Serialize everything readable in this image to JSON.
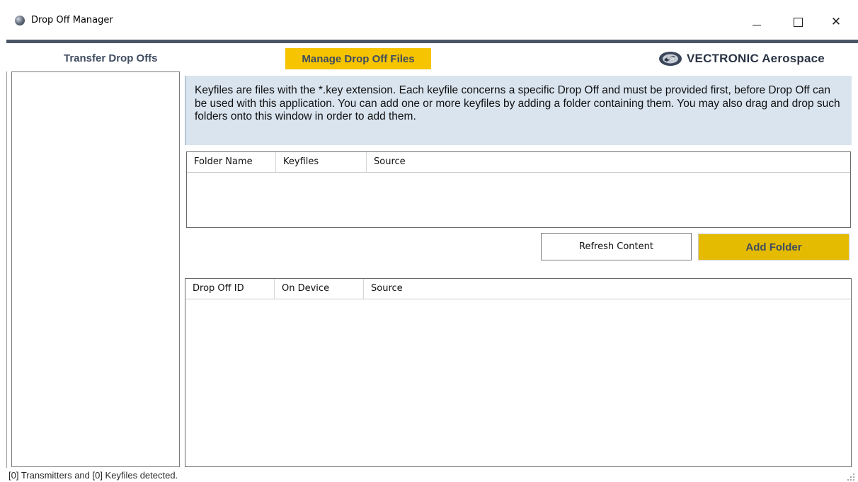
{
  "window": {
    "title": "Drop Off Manager",
    "controls": {
      "minimize": "minimize",
      "maximize": "maximize",
      "close": "✕"
    }
  },
  "header": {
    "tabs": [
      {
        "label": "Transfer Drop Offs",
        "active": false
      },
      {
        "label": "Manage Drop Off Files",
        "active": true
      }
    ],
    "brand": "VECTRONIC Aerospace"
  },
  "info": {
    "text": "Keyfiles are files with the *.key extension. Each keyfile concerns a specific Drop Off and must be provided first, before Drop Off can be used with this application. You can add one or more keyfiles by adding a folder containing them. You may also drag and drop such folders onto this window in order to add them."
  },
  "folder_table": {
    "columns": [
      "Folder Name",
      "Keyfiles",
      "Source"
    ],
    "rows": []
  },
  "buttons": {
    "refresh": "Refresh Content",
    "add_folder": "Add Folder"
  },
  "dropoff_table": {
    "columns": [
      "Drop Off ID",
      "On Device",
      "Source"
    ],
    "rows": []
  },
  "status": {
    "text": "[0] Transmitters and [0] Keyfiles detected."
  },
  "colors": {
    "accent": "#f6c400",
    "header_text": "#3f4c60",
    "info_bg": "#d9e4ef",
    "top_strip": "#4c5566"
  },
  "icons": [
    "app-globe-icon",
    "vectronic-logo-icon",
    "resize-grip-icon"
  ]
}
